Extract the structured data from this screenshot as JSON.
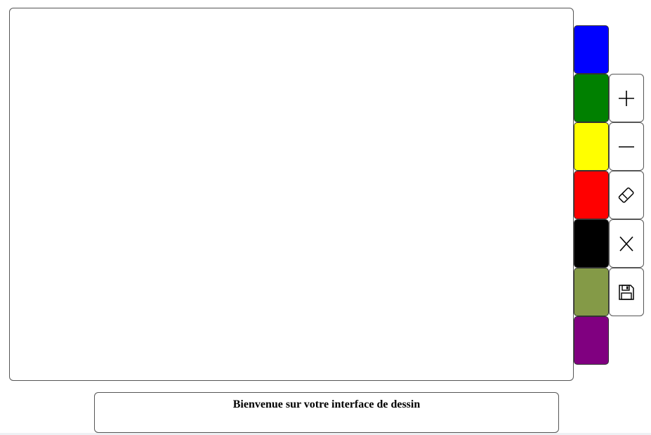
{
  "colors": {
    "swatches": [
      {
        "name": "blue",
        "hex": "#0000ff"
      },
      {
        "name": "green",
        "hex": "#008000"
      },
      {
        "name": "yellow",
        "hex": "#ffff00"
      },
      {
        "name": "red",
        "hex": "#ff0000"
      },
      {
        "name": "black",
        "hex": "#000000"
      },
      {
        "name": "olive",
        "hex": "#849a47"
      },
      {
        "name": "purple",
        "hex": "#800080"
      }
    ]
  },
  "tools": [
    {
      "icon": "plus-icon"
    },
    {
      "icon": "minus-icon"
    },
    {
      "icon": "eraser-icon"
    },
    {
      "icon": "close-icon"
    },
    {
      "icon": "save-icon"
    }
  ],
  "footer": {
    "message": "Bienvenue sur votre interface de dessin"
  }
}
